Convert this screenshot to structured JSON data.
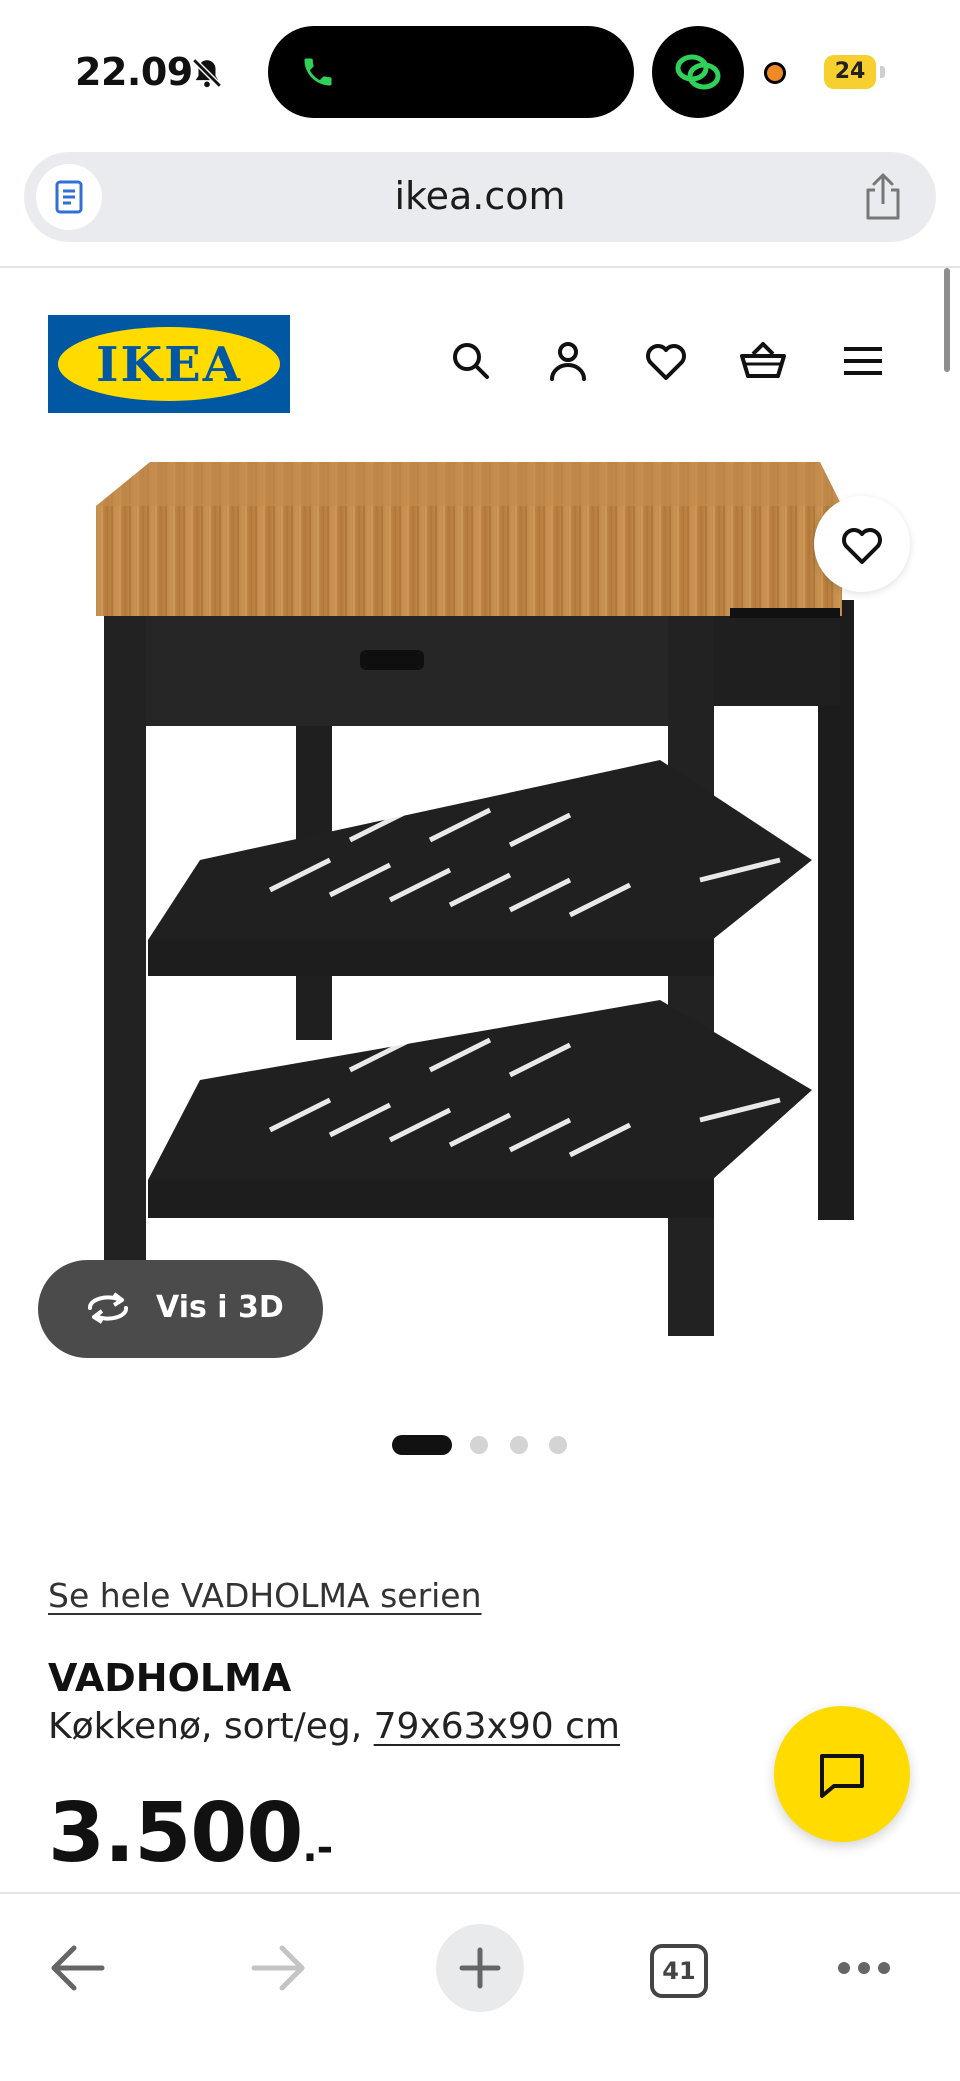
{
  "status_bar": {
    "time": "22.09",
    "battery_level": "24",
    "icons": [
      "bell-muted-icon",
      "phone-icon",
      "chain-link-icon",
      "recording-dot-icon"
    ]
  },
  "browser": {
    "url": "ikea.com",
    "open_tabs": "41",
    "icons": [
      "reader-icon",
      "share-icon",
      "back-arrow-icon",
      "forward-arrow-icon",
      "plus-icon",
      "tabs-icon",
      "more-icon"
    ]
  },
  "header": {
    "logo_text": "IKEA",
    "icons": [
      "search-icon",
      "account-icon",
      "heart-icon",
      "basket-icon",
      "menu-icon"
    ]
  },
  "gallery": {
    "view_3d_label": "Vis i 3D",
    "slide_count": 4,
    "active_slide": 1
  },
  "product": {
    "series_link": "Se hele VADHOLMA serien",
    "name": "VADHOLMA",
    "description": "Køkkenø, sort/eg, ",
    "dimensions": "79x63x90 cm",
    "price": "3.500",
    "price_suffix": ".-"
  },
  "colors": {
    "ikea_blue": "#0058a3",
    "ikea_yellow": "#ffdb00",
    "three_d_button": "#4b4b4b"
  }
}
